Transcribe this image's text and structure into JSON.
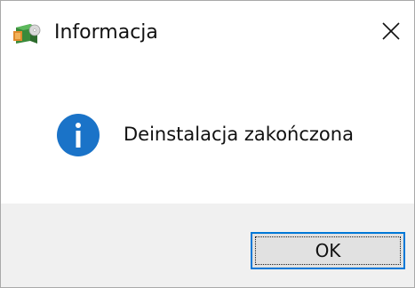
{
  "window": {
    "title": "Informacja",
    "app_icon": "setup-package-icon",
    "close_icon": "close-icon"
  },
  "content": {
    "icon": "info-icon",
    "message": "Deinstalacja zakończona"
  },
  "footer": {
    "ok_label": "OK"
  },
  "colors": {
    "info_blue": "#1a73c8",
    "focus_border": "#0078d7",
    "footer_bg": "#f0f0f0"
  }
}
